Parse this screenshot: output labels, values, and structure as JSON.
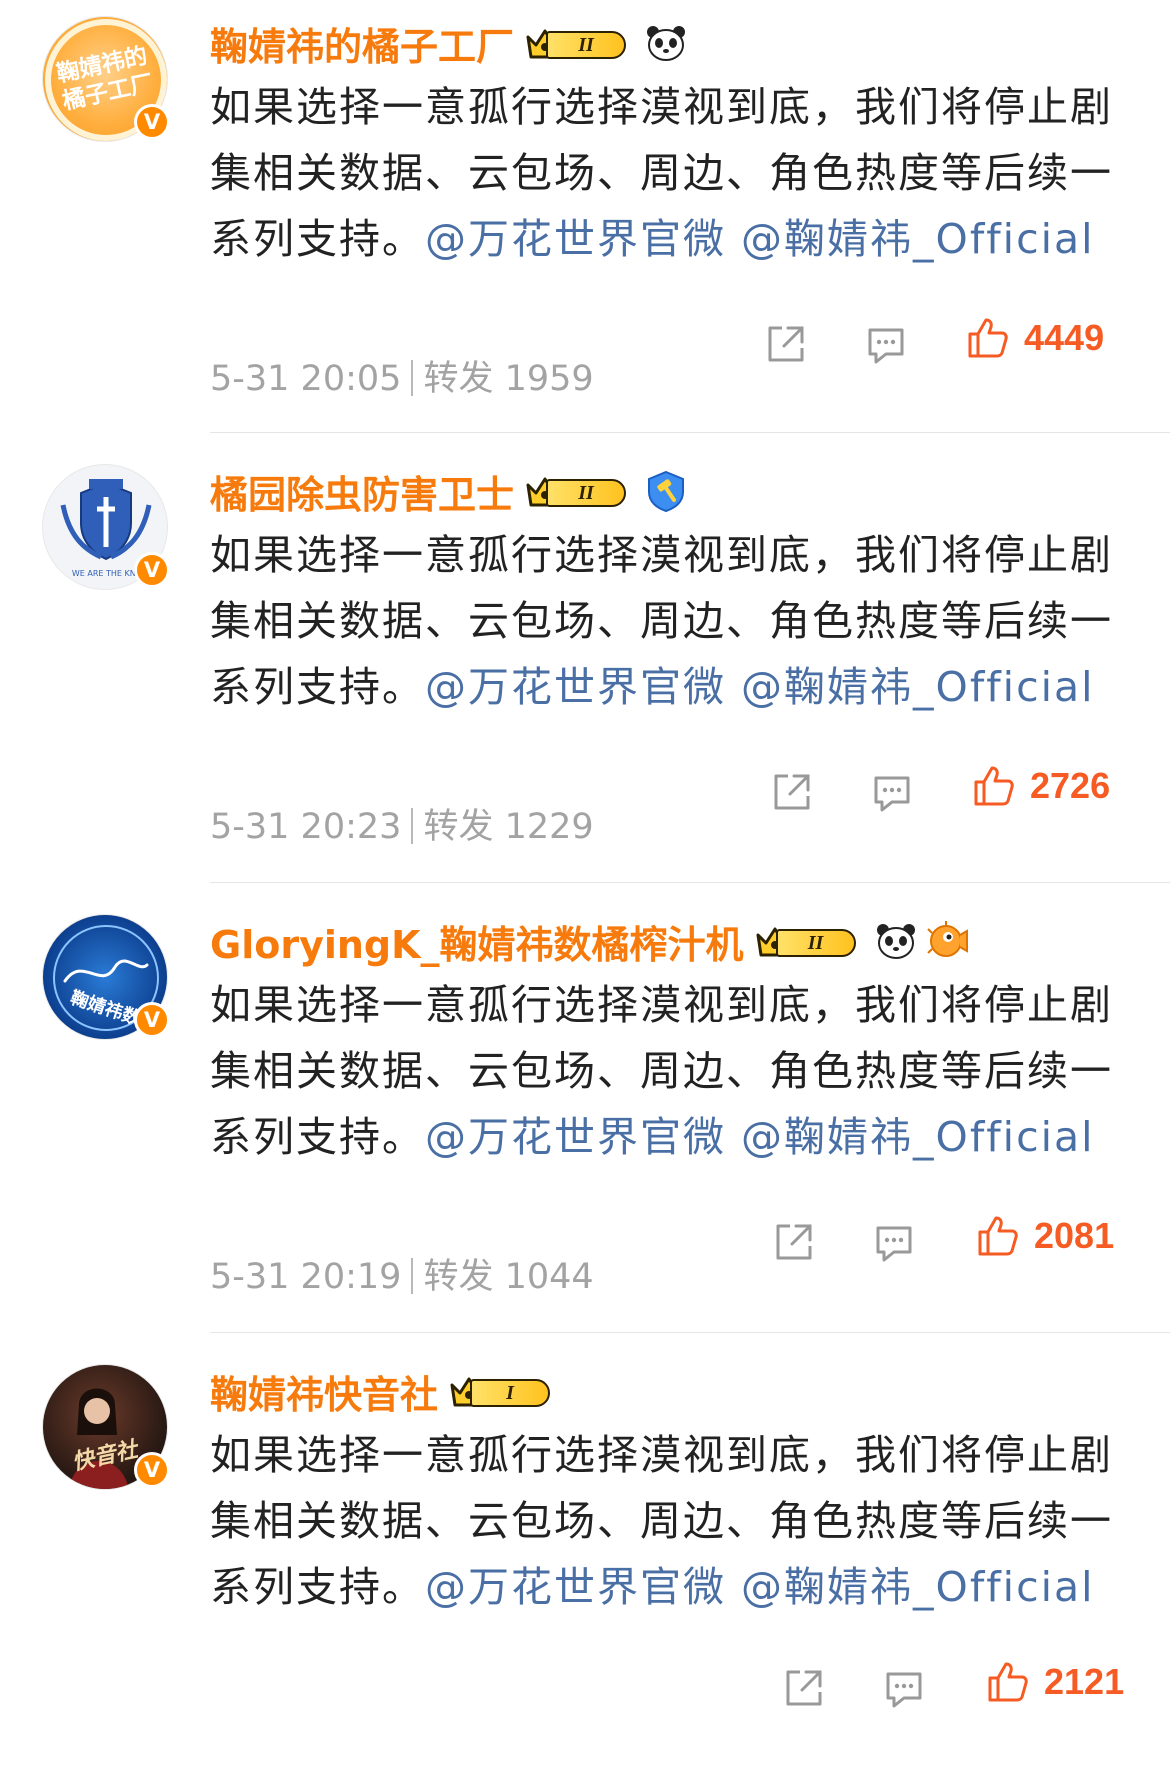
{
  "posts": [
    {
      "username": "鞠婧祎的橘子工厂",
      "avatar_text": "鞠婧祎的橘子工厂",
      "level": "II",
      "extra_badges": [
        "panda-icon"
      ],
      "content": "如果选择一意孤行选择漠视到底，我们将停止剧集相关数据、云包场、周边、角色热度等后续一系列支持。",
      "mentions": [
        "@万花世界官微",
        "@鞠婧祎_Official"
      ],
      "time": "5-31 20:05",
      "repost_label": "转发 1959",
      "likes": "4449",
      "verified_badge": "V"
    },
    {
      "username": "橘园除虫防害卫士",
      "avatar_text": "WE ARE THE KNI",
      "level": "II",
      "extra_badges": [
        "shield-hammer-icon"
      ],
      "content": "如果选择一意孤行选择漠视到底，我们将停止剧集相关数据、云包场、周边、角色热度等后续一系列支持。",
      "mentions": [
        "@万花世界官微",
        "@鞠婧祎_Official"
      ],
      "time": "5-31 20:23",
      "repost_label": "转发 1229",
      "likes": "2726",
      "verified_badge": "V"
    },
    {
      "username": "GloryingK_鞠婧祎数橘榨汁机",
      "avatar_text": "鞠婧祎数",
      "level": "II",
      "extra_badges": [
        "panda-icon",
        "pufferfish-icon"
      ],
      "content": "如果选择一意孤行选择漠视到底，我们将停止剧集相关数据、云包场、周边、角色热度等后续一系列支持。",
      "mentions": [
        "@万花世界官微",
        "@鞠婧祎_Official"
      ],
      "time": "5-31 20:19",
      "repost_label": "转发 1044",
      "likes": "2081",
      "verified_badge": "V"
    },
    {
      "username": "鞠婧祎快音社",
      "avatar_text": "快音社",
      "level": "I",
      "extra_badges": [],
      "content": "如果选择一意孤行选择漠视到底，我们将停止剧集相关数据、云包场、周边、角色热度等后续一系列支持。",
      "mentions": [
        "@万花世界官微",
        "@鞠婧祎_Official"
      ],
      "time": "",
      "repost_label": "",
      "likes": "2121",
      "verified_badge": "V"
    }
  ],
  "colors": {
    "username": "#F77A0C",
    "mention": "#4A6FA5",
    "like": "#F55B23",
    "meta": "#A3A3A3",
    "verified": "#FF8A00"
  }
}
